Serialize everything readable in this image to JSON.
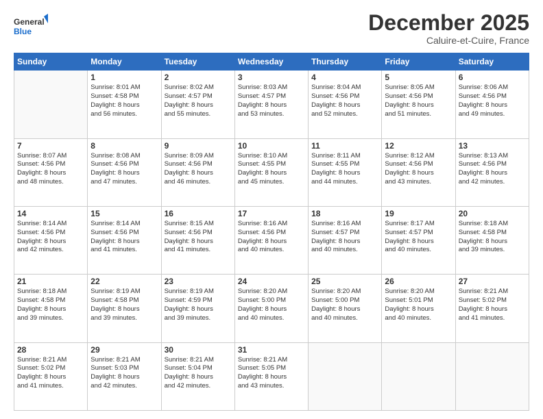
{
  "header": {
    "logo_line1": "General",
    "logo_line2": "Blue",
    "month": "December 2025",
    "location": "Caluire-et-Cuire, France"
  },
  "weekdays": [
    "Sunday",
    "Monday",
    "Tuesday",
    "Wednesday",
    "Thursday",
    "Friday",
    "Saturday"
  ],
  "weeks": [
    [
      {
        "day": "",
        "info": ""
      },
      {
        "day": "1",
        "info": "Sunrise: 8:01 AM\nSunset: 4:58 PM\nDaylight: 8 hours\nand 56 minutes."
      },
      {
        "day": "2",
        "info": "Sunrise: 8:02 AM\nSunset: 4:57 PM\nDaylight: 8 hours\nand 55 minutes."
      },
      {
        "day": "3",
        "info": "Sunrise: 8:03 AM\nSunset: 4:57 PM\nDaylight: 8 hours\nand 53 minutes."
      },
      {
        "day": "4",
        "info": "Sunrise: 8:04 AM\nSunset: 4:56 PM\nDaylight: 8 hours\nand 52 minutes."
      },
      {
        "day": "5",
        "info": "Sunrise: 8:05 AM\nSunset: 4:56 PM\nDaylight: 8 hours\nand 51 minutes."
      },
      {
        "day": "6",
        "info": "Sunrise: 8:06 AM\nSunset: 4:56 PM\nDaylight: 8 hours\nand 49 minutes."
      }
    ],
    [
      {
        "day": "7",
        "info": "Sunrise: 8:07 AM\nSunset: 4:56 PM\nDaylight: 8 hours\nand 48 minutes."
      },
      {
        "day": "8",
        "info": "Sunrise: 8:08 AM\nSunset: 4:56 PM\nDaylight: 8 hours\nand 47 minutes."
      },
      {
        "day": "9",
        "info": "Sunrise: 8:09 AM\nSunset: 4:56 PM\nDaylight: 8 hours\nand 46 minutes."
      },
      {
        "day": "10",
        "info": "Sunrise: 8:10 AM\nSunset: 4:55 PM\nDaylight: 8 hours\nand 45 minutes."
      },
      {
        "day": "11",
        "info": "Sunrise: 8:11 AM\nSunset: 4:55 PM\nDaylight: 8 hours\nand 44 minutes."
      },
      {
        "day": "12",
        "info": "Sunrise: 8:12 AM\nSunset: 4:56 PM\nDaylight: 8 hours\nand 43 minutes."
      },
      {
        "day": "13",
        "info": "Sunrise: 8:13 AM\nSunset: 4:56 PM\nDaylight: 8 hours\nand 42 minutes."
      }
    ],
    [
      {
        "day": "14",
        "info": "Sunrise: 8:14 AM\nSunset: 4:56 PM\nDaylight: 8 hours\nand 42 minutes."
      },
      {
        "day": "15",
        "info": "Sunrise: 8:14 AM\nSunset: 4:56 PM\nDaylight: 8 hours\nand 41 minutes."
      },
      {
        "day": "16",
        "info": "Sunrise: 8:15 AM\nSunset: 4:56 PM\nDaylight: 8 hours\nand 41 minutes."
      },
      {
        "day": "17",
        "info": "Sunrise: 8:16 AM\nSunset: 4:56 PM\nDaylight: 8 hours\nand 40 minutes."
      },
      {
        "day": "18",
        "info": "Sunrise: 8:16 AM\nSunset: 4:57 PM\nDaylight: 8 hours\nand 40 minutes."
      },
      {
        "day": "19",
        "info": "Sunrise: 8:17 AM\nSunset: 4:57 PM\nDaylight: 8 hours\nand 40 minutes."
      },
      {
        "day": "20",
        "info": "Sunrise: 8:18 AM\nSunset: 4:58 PM\nDaylight: 8 hours\nand 39 minutes."
      }
    ],
    [
      {
        "day": "21",
        "info": "Sunrise: 8:18 AM\nSunset: 4:58 PM\nDaylight: 8 hours\nand 39 minutes."
      },
      {
        "day": "22",
        "info": "Sunrise: 8:19 AM\nSunset: 4:58 PM\nDaylight: 8 hours\nand 39 minutes."
      },
      {
        "day": "23",
        "info": "Sunrise: 8:19 AM\nSunset: 4:59 PM\nDaylight: 8 hours\nand 39 minutes."
      },
      {
        "day": "24",
        "info": "Sunrise: 8:20 AM\nSunset: 5:00 PM\nDaylight: 8 hours\nand 40 minutes."
      },
      {
        "day": "25",
        "info": "Sunrise: 8:20 AM\nSunset: 5:00 PM\nDaylight: 8 hours\nand 40 minutes."
      },
      {
        "day": "26",
        "info": "Sunrise: 8:20 AM\nSunset: 5:01 PM\nDaylight: 8 hours\nand 40 minutes."
      },
      {
        "day": "27",
        "info": "Sunrise: 8:21 AM\nSunset: 5:02 PM\nDaylight: 8 hours\nand 41 minutes."
      }
    ],
    [
      {
        "day": "28",
        "info": "Sunrise: 8:21 AM\nSunset: 5:02 PM\nDaylight: 8 hours\nand 41 minutes."
      },
      {
        "day": "29",
        "info": "Sunrise: 8:21 AM\nSunset: 5:03 PM\nDaylight: 8 hours\nand 42 minutes."
      },
      {
        "day": "30",
        "info": "Sunrise: 8:21 AM\nSunset: 5:04 PM\nDaylight: 8 hours\nand 42 minutes."
      },
      {
        "day": "31",
        "info": "Sunrise: 8:21 AM\nSunset: 5:05 PM\nDaylight: 8 hours\nand 43 minutes."
      },
      {
        "day": "",
        "info": ""
      },
      {
        "day": "",
        "info": ""
      },
      {
        "day": "",
        "info": ""
      }
    ]
  ]
}
